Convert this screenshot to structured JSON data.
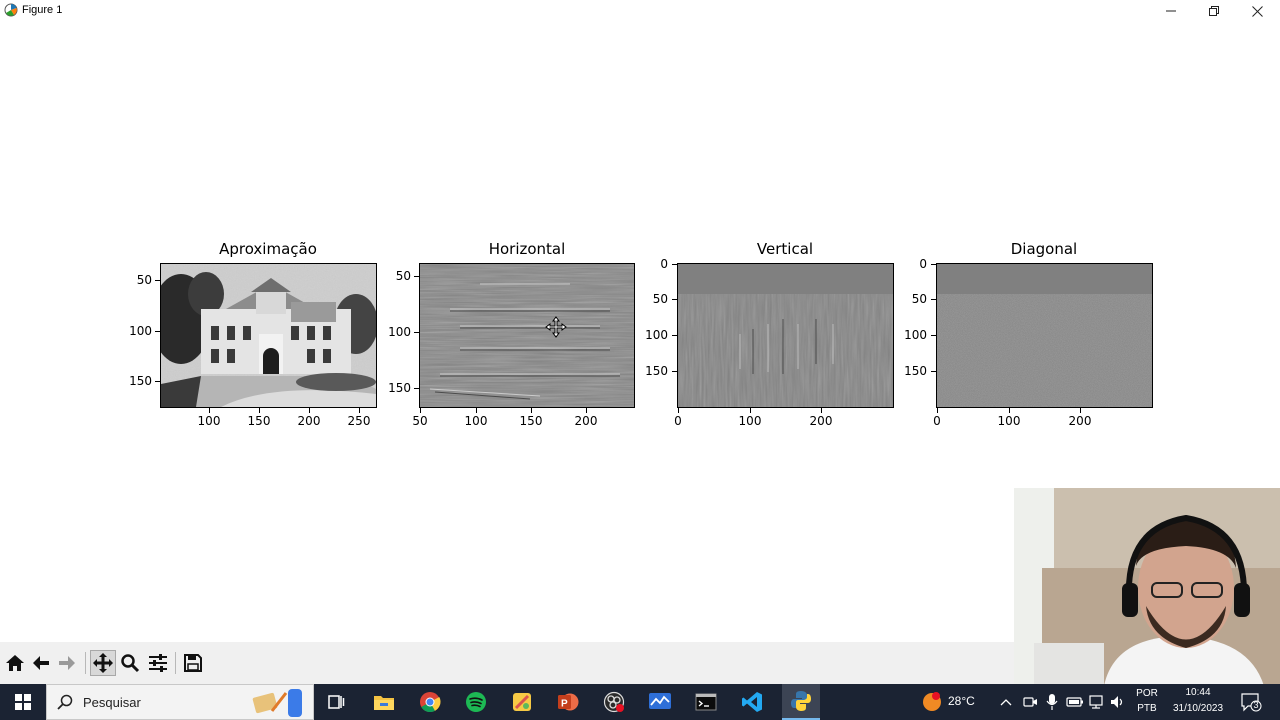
{
  "window": {
    "title": "Figure 1",
    "icons": [
      "matplotlib-icon",
      "minimize-icon",
      "restore-icon",
      "close-icon"
    ]
  },
  "figure": {
    "subplots": [
      {
        "title": "Aproximação",
        "xticks": [
          "100",
          "150",
          "200",
          "250"
        ],
        "yticks": [
          "50",
          "100",
          "150"
        ],
        "image": "grayscale-house-photo"
      },
      {
        "title": "Horizontal",
        "xticks": [
          "50",
          "100",
          "150",
          "200"
        ],
        "yticks": [
          "50",
          "100",
          "150"
        ],
        "image": "horizontal-detail-coefficients"
      },
      {
        "title": "Vertical",
        "xticks": [
          "0",
          "100",
          "200"
        ],
        "yticks": [
          "0",
          "50",
          "100",
          "150"
        ],
        "image": "vertical-detail-coefficients"
      },
      {
        "title": "Diagonal",
        "xticks": [
          "0",
          "100",
          "200"
        ],
        "yticks": [
          "0",
          "50",
          "100",
          "150"
        ],
        "image": "diagonal-detail-coefficients"
      }
    ]
  },
  "toolbar": {
    "icons": [
      "home-icon",
      "back-icon",
      "forward-icon",
      "pan-icon",
      "zoom-icon",
      "configure-icon",
      "save-icon"
    ]
  },
  "taskbar": {
    "search_label": "Pesquisar",
    "weather_temp": "28°C",
    "language_top": "POR",
    "language_bottom": "PTB",
    "time": "10:44",
    "date": "31/10/2023",
    "notification_count": "3",
    "colors": {
      "taskbar_bg": "#1b2333",
      "chrome": "#4caf50",
      "spotify": "#1db954",
      "powerpoint": "#d24726",
      "vscode": "#007acc"
    }
  }
}
